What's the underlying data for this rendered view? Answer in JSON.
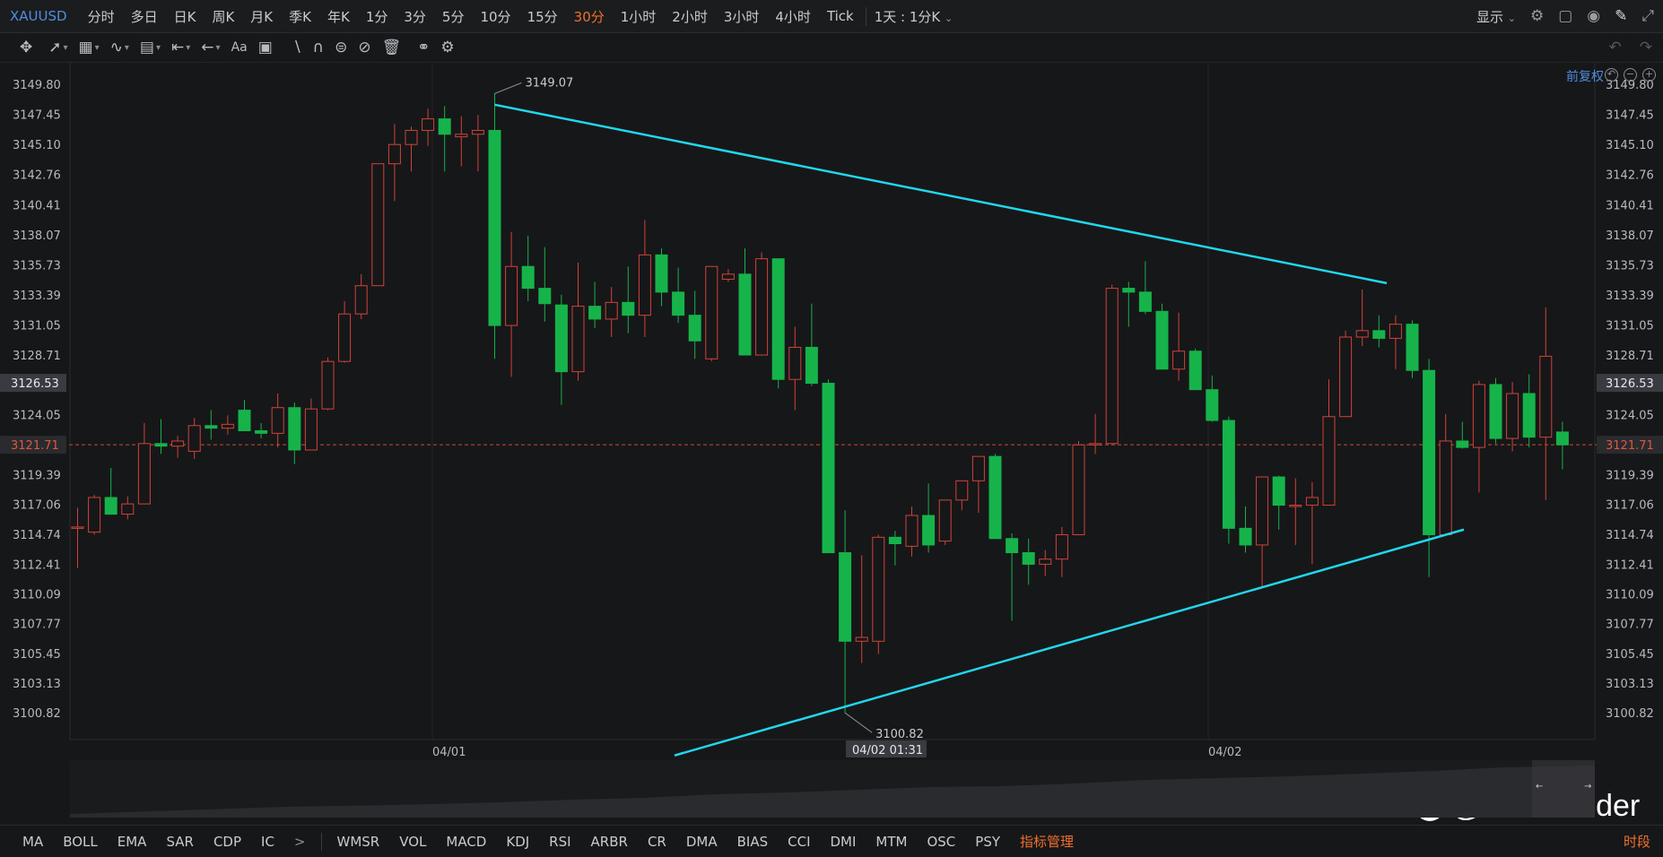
{
  "symbol": "XAUUSD",
  "timeframes": [
    "分时",
    "多日",
    "日K",
    "周K",
    "月K",
    "季K",
    "年K",
    "1分",
    "3分",
    "5分",
    "10分",
    "15分",
    "30分",
    "1小时",
    "2小时",
    "3小时",
    "4小时",
    "Tick"
  ],
  "active_timeframe": "30分",
  "timeframe_dropdown": "1天 : 1分K",
  "display_button": "显示",
  "fuquan_label": "前复权",
  "right_price_axis": [
    "3149.80",
    "3147.45",
    "3145.10",
    "3142.76",
    "3140.41",
    "3138.07",
    "3135.73",
    "3133.39",
    "3131.05",
    "3128.71",
    "3126.53",
    "3124.05",
    "3121.71",
    "3119.39",
    "3117.06",
    "3114.74",
    "3112.41",
    "3110.09",
    "3107.77",
    "3105.45",
    "3103.13",
    "3100.82"
  ],
  "left_price_axis": [
    "3149.80",
    "3147.45",
    "3145.10",
    "3142.76",
    "3140.41",
    "3138.07",
    "3135.73",
    "3133.39",
    "3131.05",
    "3128.71",
    "3126.53",
    "3124.05",
    "3121.71",
    "3119.39",
    "3117.06",
    "3114.74",
    "3112.41",
    "3110.09",
    "3107.77",
    "3105.45",
    "3103.13",
    "3100.82"
  ],
  "date_labels": [
    "04/01",
    "04/02 01:31",
    "04/02"
  ],
  "high_marker": "3149.07",
  "low_marker": "3100.82",
  "current_price": "3121.71",
  "crosshair_price": "3126.53",
  "indicators": [
    "MA",
    "BOLL",
    "EMA",
    "SAR",
    "CDP",
    "IC",
    "WMSR",
    "VOL",
    "MACD",
    "KDJ",
    "RSI",
    "ARBR",
    "CR",
    "DMA",
    "BIAS",
    "CCI",
    "DMI",
    "MTM",
    "OSC",
    "PSY"
  ],
  "more_indicators_arrow": ">",
  "indicator_manager": "指标管理",
  "period_button": "时段",
  "watermark_text": "@RiskSonder",
  "colors": {
    "up": "#d2423a",
    "down": "#16b24a",
    "trendline": "#22d7ec",
    "accent": "#f0702c",
    "link": "#4e8de0"
  },
  "chart_data": {
    "type": "candlestick",
    "candles": [
      [
        3115.3,
        3116.8,
        3112.1,
        3115.3
      ],
      [
        3114.9,
        3117.8,
        3114.7,
        3117.6
      ],
      [
        3117.6,
        3119.9,
        3116.3,
        3116.3
      ],
      [
        3116.3,
        3117.7,
        3115.9,
        3117.1
      ],
      [
        3117.1,
        3123.4,
        3117.1,
        3121.8
      ],
      [
        3121.8,
        3123.7,
        3121.0,
        3121.6
      ],
      [
        3121.6,
        3122.4,
        3120.7,
        3122.0
      ],
      [
        3121.2,
        3123.8,
        3120.6,
        3123.2
      ],
      [
        3123.2,
        3124.4,
        3122.1,
        3123.0
      ],
      [
        3123.0,
        3124.0,
        3122.5,
        3123.3
      ],
      [
        3124.4,
        3125.2,
        3122.8,
        3122.8
      ],
      [
        3122.8,
        3123.4,
        3122.2,
        3122.6
      ],
      [
        3122.6,
        3125.7,
        3121.5,
        3124.6
      ],
      [
        3124.6,
        3125.0,
        3120.2,
        3121.3
      ],
      [
        3121.3,
        3125.3,
        3121.3,
        3124.5
      ],
      [
        3124.5,
        3128.5,
        3124.4,
        3128.2
      ],
      [
        3128.2,
        3132.9,
        3128.1,
        3131.9
      ],
      [
        3131.9,
        3135.0,
        3131.5,
        3134.1
      ],
      [
        3134.1,
        3143.6,
        3134.1,
        3143.6
      ],
      [
        3143.6,
        3146.7,
        3140.7,
        3145.1
      ],
      [
        3145.1,
        3146.5,
        3143.0,
        3146.2
      ],
      [
        3146.2,
        3147.9,
        3145.0,
        3147.1
      ],
      [
        3147.1,
        3148.1,
        3143.0,
        3145.9
      ],
      [
        3145.7,
        3147.3,
        3143.4,
        3145.9
      ],
      [
        3145.9,
        3147.4,
        3143.0,
        3146.2
      ],
      [
        3146.2,
        3149.1,
        3128.4,
        3131.0
      ],
      [
        3131.0,
        3138.3,
        3127.0,
        3135.6
      ],
      [
        3135.6,
        3138.0,
        3132.9,
        3133.9
      ],
      [
        3133.9,
        3137.1,
        3131.3,
        3132.7
      ],
      [
        3132.6,
        3133.4,
        3124.8,
        3127.4
      ],
      [
        3127.4,
        3135.9,
        3126.7,
        3132.5
      ],
      [
        3132.5,
        3134.4,
        3130.8,
        3131.5
      ],
      [
        3131.5,
        3134.0,
        3130.1,
        3132.8
      ],
      [
        3132.8,
        3135.6,
        3130.4,
        3131.8
      ],
      [
        3131.8,
        3139.2,
        3130.1,
        3136.5
      ],
      [
        3136.5,
        3137.0,
        3132.5,
        3133.6
      ],
      [
        3133.6,
        3135.5,
        3131.2,
        3131.8
      ],
      [
        3131.8,
        3133.7,
        3128.4,
        3129.8
      ],
      [
        3128.4,
        3135.6,
        3128.2,
        3135.6
      ],
      [
        3134.6,
        3135.4,
        3134.4,
        3135.0
      ],
      [
        3135.0,
        3137.0,
        3128.7,
        3128.7
      ],
      [
        3128.7,
        3136.7,
        3128.7,
        3136.2
      ],
      [
        3136.2,
        3136.2,
        3126.1,
        3126.8
      ],
      [
        3126.8,
        3130.9,
        3124.4,
        3129.3
      ],
      [
        3129.3,
        3132.7,
        3126.3,
        3126.5
      ],
      [
        3126.5,
        3126.8,
        3113.3,
        3113.3
      ],
      [
        3113.3,
        3116.6,
        3100.8,
        3106.4
      ],
      [
        3106.4,
        3113.1,
        3104.7,
        3106.7
      ],
      [
        3106.4,
        3114.7,
        3105.4,
        3114.5
      ],
      [
        3114.5,
        3115.0,
        3112.3,
        3114.0
      ],
      [
        3113.8,
        3116.9,
        3113.0,
        3116.2
      ],
      [
        3116.2,
        3118.7,
        3113.3,
        3113.9
      ],
      [
        3114.2,
        3116.9,
        3113.9,
        3117.4
      ],
      [
        3117.4,
        3118.1,
        3116.6,
        3118.9
      ],
      [
        3118.9,
        3120.8,
        3116.4,
        3120.8
      ],
      [
        3120.8,
        3121.0,
        3114.4,
        3114.4
      ],
      [
        3114.4,
        3114.8,
        3108.0,
        3113.3
      ],
      [
        3113.3,
        3114.4,
        3110.8,
        3112.4
      ],
      [
        3112.4,
        3113.5,
        3111.5,
        3112.8
      ],
      [
        3112.8,
        3115.3,
        3111.4,
        3114.7
      ],
      [
        3114.7,
        3122.0,
        3114.7,
        3121.7
      ],
      [
        3121.7,
        3124.1,
        3121.0,
        3121.8
      ],
      [
        3121.8,
        3134.2,
        3121.8,
        3133.9
      ],
      [
        3133.9,
        3134.4,
        3130.9,
        3133.6
      ],
      [
        3133.6,
        3136.0,
        3131.9,
        3132.1
      ],
      [
        3132.1,
        3132.7,
        3127.7,
        3127.6
      ],
      [
        3127.6,
        3132.0,
        3126.7,
        3129.0
      ],
      [
        3129.0,
        3129.2,
        3126.0,
        3126.0
      ],
      [
        3126.0,
        3127.1,
        3123.5,
        3123.6
      ],
      [
        3123.6,
        3123.9,
        3114.0,
        3115.2
      ],
      [
        3115.2,
        3116.9,
        3113.3,
        3113.9
      ],
      [
        3113.9,
        3119.2,
        3110.6,
        3119.2
      ],
      [
        3119.2,
        3119.3,
        3115.1,
        3117.0
      ],
      [
        3117.0,
        3119.1,
        3113.9,
        3117.0
      ],
      [
        3117.0,
        3118.8,
        3112.4,
        3117.6
      ],
      [
        3117.0,
        3126.8,
        3117.0,
        3123.9
      ],
      [
        3123.9,
        3130.6,
        3123.9,
        3130.1
      ],
      [
        3130.1,
        3133.8,
        3129.4,
        3130.6
      ],
      [
        3130.6,
        3131.8,
        3129.3,
        3130.0
      ],
      [
        3130.0,
        3131.8,
        3127.6,
        3131.1
      ],
      [
        3131.1,
        3131.4,
        3126.9,
        3127.5
      ],
      [
        3127.5,
        3128.4,
        3111.4,
        3114.7
      ],
      [
        3114.7,
        3124.1,
        3114.7,
        3122.0
      ],
      [
        3122.0,
        3123.5,
        3121.4,
        3121.5
      ],
      [
        3121.5,
        3126.7,
        3118.0,
        3126.4
      ],
      [
        3126.4,
        3126.9,
        3121.8,
        3122.2
      ],
      [
        3122.2,
        3126.6,
        3121.2,
        3125.7
      ],
      [
        3125.7,
        3127.2,
        3121.5,
        3122.3
      ],
      [
        3122.3,
        3132.4,
        3117.4,
        3128.6
      ],
      [
        3122.7,
        3123.5,
        3119.8,
        3121.7
      ]
    ],
    "trendlines": [
      {
        "from": [
          "04/01 ~03:00",
          3148.2
        ],
        "to": [
          "04/02 ~08:00",
          3134.3
        ]
      },
      {
        "from": [
          "04/01 ~22:00",
          3097.5
        ],
        "to": [
          "04/02 ~12:30",
          3115.1
        ]
      }
    ],
    "ylim": [
      3098.6,
      3151.4
    ],
    "x_ticks": [
      "04/01",
      "04/02"
    ],
    "grid": true
  }
}
